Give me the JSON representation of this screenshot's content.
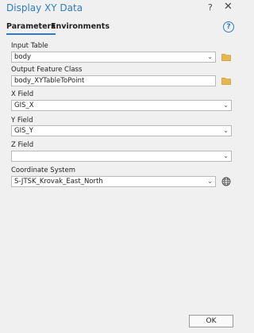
{
  "window": {
    "title": "Display XY Data",
    "help_glyph": "?",
    "close_glyph": "✕"
  },
  "tabs": [
    {
      "label": "Parameters",
      "active": true
    },
    {
      "label": "Environments",
      "active": false
    }
  ],
  "help_button_glyph": "?",
  "fields": {
    "input_table": {
      "label": "Input Table",
      "value": "body",
      "type": "dropdown",
      "icon": "folder-icon"
    },
    "output_feature_class": {
      "label": "Output Feature Class",
      "value": "body_XYTableToPoint",
      "type": "text",
      "icon": "folder-icon"
    },
    "x_field": {
      "label": "X Field",
      "value": "GIS_X",
      "type": "dropdown"
    },
    "y_field": {
      "label": "Y Field",
      "value": "GIS_Y",
      "type": "dropdown"
    },
    "z_field": {
      "label": "Z Field",
      "value": "",
      "type": "dropdown"
    },
    "coordinate_system": {
      "label": "Coordinate System",
      "value": "S-JTSK_Krovak_East_North",
      "type": "dropdown",
      "icon": "globe-icon"
    }
  },
  "ok_label": "OK",
  "colors": {
    "accent": "#2e7dc3",
    "folder": "#e6b84a",
    "background": "#f0f0f0"
  }
}
